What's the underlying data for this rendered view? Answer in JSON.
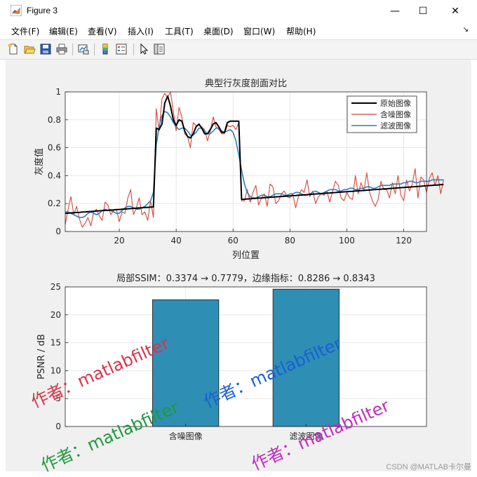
{
  "window": {
    "title": "Figure 3",
    "minimize": "—",
    "maximize": "☐",
    "close": "✕"
  },
  "menu": {
    "items": [
      "文件(F)",
      "编辑(E)",
      "查看(V)",
      "插入(I)",
      "工具(T)",
      "桌面(D)",
      "窗口(W)",
      "帮助(H)"
    ],
    "overflow_arrow": "↘"
  },
  "toolbar": {
    "icons": [
      "new-figure-icon",
      "open-file-icon",
      "save-icon",
      "print-icon",
      "link-plot-icon",
      "colorbar-icon",
      "legend-icon",
      "pointer-icon",
      "property-inspector-icon"
    ]
  },
  "chart_data": [
    {
      "type": "line",
      "title": "典型行灰度剖面对比",
      "xlabel": "列位置",
      "ylabel": "灰度值",
      "xlim": [
        1,
        128
      ],
      "ylim": [
        0,
        1
      ],
      "xticks": [
        "20",
        "40",
        "60",
        "80",
        "100",
        "120"
      ],
      "yticks": [
        "0",
        "0.2",
        "0.4",
        "0.6",
        "0.8",
        "1"
      ],
      "grid": true,
      "legend_position": "top-right",
      "series": [
        {
          "name": "原始图像",
          "color": "#000000",
          "values": [
            0.13,
            0.131,
            0.133,
            0.134,
            0.136,
            0.137,
            0.139,
            0.14,
            0.142,
            0.143,
            0.145,
            0.146,
            0.148,
            0.149,
            0.151,
            0.152,
            0.154,
            0.155,
            0.157,
            0.158,
            0.16,
            0.161,
            0.163,
            0.164,
            0.166,
            0.167,
            0.169,
            0.17,
            0.172,
            0.173,
            0.175,
            0.176,
            0.74,
            0.73,
            0.77,
            0.92,
            0.97,
            0.9,
            0.8,
            0.76,
            0.8,
            0.79,
            0.72,
            0.68,
            0.67,
            0.7,
            0.75,
            0.77,
            0.74,
            0.7,
            0.7,
            0.73,
            0.77,
            0.78,
            0.75,
            0.71,
            0.71,
            0.78,
            0.79,
            0.79,
            0.79,
            0.79,
            0.23,
            0.231,
            0.233,
            0.234,
            0.236,
            0.237,
            0.239,
            0.24,
            0.242,
            0.243,
            0.245,
            0.246,
            0.248,
            0.249,
            0.251,
            0.252,
            0.254,
            0.255,
            0.257,
            0.258,
            0.26,
            0.261,
            0.263,
            0.264,
            0.266,
            0.267,
            0.269,
            0.27,
            0.272,
            0.273,
            0.275,
            0.276,
            0.278,
            0.279,
            0.281,
            0.282,
            0.284,
            0.285,
            0.287,
            0.288,
            0.29,
            0.291,
            0.293,
            0.294,
            0.296,
            0.297,
            0.299,
            0.3,
            0.302,
            0.303,
            0.305,
            0.306,
            0.308,
            0.309,
            0.311,
            0.312,
            0.314,
            0.315,
            0.317,
            0.318,
            0.32,
            0.321,
            0.323,
            0.324,
            0.326,
            0.327,
            0.329,
            0.33,
            0.332,
            0.333,
            0.335,
            0.336
          ]
        },
        {
          "name": "含噪图像",
          "color": "#d4463a",
          "values": [
            0.05,
            0.16,
            0.25,
            0.12,
            0.18,
            0.09,
            0.03,
            0.06,
            0.1,
            0.04,
            0.14,
            0.16,
            0.11,
            0.08,
            0.21,
            0.19,
            0.12,
            0.15,
            0.16,
            0.07,
            0.14,
            0.13,
            0.24,
            0.3,
            0.12,
            0.17,
            0.24,
            0.12,
            0.14,
            0.08,
            0.22,
            0.1,
            0.88,
            0.72,
            0.95,
            0.99,
            0.96,
            1.0,
            0.86,
            0.72,
            0.89,
            0.82,
            0.7,
            0.68,
            0.6,
            0.78,
            0.76,
            0.76,
            0.75,
            0.73,
            0.65,
            0.72,
            0.82,
            0.75,
            0.73,
            0.7,
            0.7,
            0.76,
            0.75,
            0.76,
            0.73,
            0.78,
            0.22,
            0.22,
            0.3,
            0.21,
            0.28,
            0.33,
            0.19,
            0.24,
            0.27,
            0.18,
            0.34,
            0.32,
            0.2,
            0.22,
            0.27,
            0.29,
            0.25,
            0.24,
            0.27,
            0.17,
            0.25,
            0.3,
            0.28,
            0.37,
            0.25,
            0.29,
            0.2,
            0.25,
            0.27,
            0.26,
            0.29,
            0.21,
            0.29,
            0.36,
            0.33,
            0.24,
            0.22,
            0.28,
            0.24,
            0.23,
            0.4,
            0.27,
            0.35,
            0.29,
            0.42,
            0.28,
            0.22,
            0.18,
            0.23,
            0.36,
            0.3,
            0.3,
            0.24,
            0.35,
            0.27,
            0.4,
            0.26,
            0.22,
            0.37,
            0.29,
            0.34,
            0.45,
            0.24,
            0.39,
            0.37,
            0.28,
            0.38,
            0.42,
            0.33,
            0.4,
            0.27,
            0.37
          ]
        },
        {
          "name": "滤波图像",
          "color": "#2a7fc0",
          "values": [
            0.14,
            0.14,
            0.13,
            0.12,
            0.11,
            0.1,
            0.1,
            0.11,
            0.13,
            0.14,
            0.13,
            0.12,
            0.13,
            0.15,
            0.16,
            0.15,
            0.15,
            0.14,
            0.13,
            0.13,
            0.15,
            0.17,
            0.18,
            0.18,
            0.17,
            0.16,
            0.16,
            0.17,
            0.18,
            0.2,
            0.22,
            0.28,
            0.62,
            0.75,
            0.83,
            0.86,
            0.85,
            0.82,
            0.78,
            0.75,
            0.73,
            0.74,
            0.74,
            0.72,
            0.69,
            0.69,
            0.71,
            0.74,
            0.74,
            0.72,
            0.7,
            0.7,
            0.72,
            0.74,
            0.74,
            0.72,
            0.71,
            0.72,
            0.73,
            0.71,
            0.65,
            0.55,
            0.44,
            0.34,
            0.28,
            0.25,
            0.24,
            0.24,
            0.25,
            0.26,
            0.26,
            0.25,
            0.25,
            0.26,
            0.27,
            0.27,
            0.27,
            0.26,
            0.26,
            0.27,
            0.27,
            0.28,
            0.28,
            0.27,
            0.26,
            0.26,
            0.27,
            0.28,
            0.29,
            0.28,
            0.27,
            0.28,
            0.29,
            0.3,
            0.3,
            0.3,
            0.29,
            0.29,
            0.3,
            0.3,
            0.31,
            0.31,
            0.3,
            0.3,
            0.31,
            0.31,
            0.32,
            0.32,
            0.31,
            0.31,
            0.32,
            0.33,
            0.33,
            0.33,
            0.33,
            0.34,
            0.34,
            0.34,
            0.34,
            0.35,
            0.35,
            0.36,
            0.36,
            0.35,
            0.35,
            0.36,
            0.36,
            0.36,
            0.36,
            0.37,
            0.37,
            0.37,
            0.37,
            0.37
          ]
        }
      ]
    },
    {
      "type": "bar",
      "title": "局部SSIM：0.3374 → 0.7779，边缘指标：0.8286 → 0.8343",
      "xlabel": "",
      "ylabel": "PSNR / dB",
      "categories": [
        "含噪图像",
        "滤波图像"
      ],
      "values": [
        22.7,
        24.6
      ],
      "ylim": [
        0,
        25
      ],
      "yticks": [
        "0",
        "5",
        "10",
        "15",
        "20",
        "25"
      ],
      "bar_color": "#2f8eb4",
      "grid": true
    }
  ],
  "watermarks": [
    "作者：matlabfilter",
    "作者：matlabfilter",
    "作者：matlabfilter",
    "作者：matlabfilter"
  ],
  "watermark_colors": [
    "#d9344a",
    "#1a5fd6",
    "#1f9a3c",
    "#c22ac2"
  ],
  "footer": "CSDN @MATLAB卡尔曼"
}
